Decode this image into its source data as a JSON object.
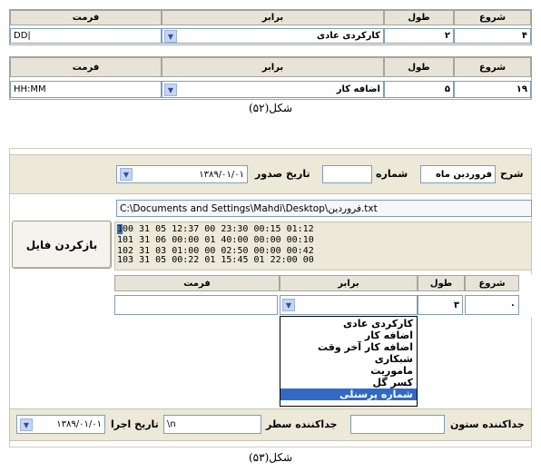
{
  "fig1": {
    "table1": {
      "headers": {
        "start": "شروع",
        "length": "طول",
        "equal": "برابر",
        "format": "فرمت"
      },
      "row": {
        "start": "۴",
        "length": "۲",
        "equal": "کارکردی عادی",
        "format": "DD|"
      }
    },
    "table2": {
      "headers": {
        "start": "شروع",
        "length": "طول",
        "equal": "برابر",
        "format": "فرمت"
      },
      "row": {
        "start": "۱۹",
        "length": "۵",
        "equal": "اضافه کار",
        "format": "HH:MM"
      }
    },
    "caption": "شکل(۵۲)"
  },
  "fig2": {
    "header": {
      "description_label": "شرح",
      "description_value": "فروردین ماه",
      "number_label": "شماره",
      "number_value": "",
      "issue_date_label": "تاریخ صدور",
      "issue_date_value": "۱۳۸۹/۰۱/۰۱"
    },
    "path": "C:\\Documents and Settings\\Mahdi\\Desktop\\فروردین.txt",
    "open_file_button": "بازکردن فایل",
    "file_lines": [
      "100 31 05 12:37 00 23:30 00:15 01:12",
      "101 31 06 00:00 01 40:00 00:00 00:10",
      "102 31 03 01:00 00 02:50 00:00 00:42",
      "103 31 05 00:22 01 15:45 01 22:00 00"
    ],
    "mapping": {
      "headers": {
        "start": "شروع",
        "length": "طول",
        "equal": "برابر",
        "format": "فرمت"
      },
      "row": {
        "start": "۰",
        "length": "۳",
        "equal": "",
        "format": ""
      }
    },
    "dropdown_options": [
      "کارکردی عادی",
      "اضافه کار",
      "اضافه کار آخر وقت",
      "شبکاری",
      "ماموریت",
      "کسر گل",
      "شماره پرسنلی"
    ],
    "selected_option_index": 6,
    "footer": {
      "column_sep_label": "جداکننده ستون",
      "column_sep_value": "",
      "row_sep_label": "جداکننده سطر",
      "row_sep_value": "\\n",
      "run_date_label": "تاریخ اجرا",
      "run_date_value": "۱۳۸۹/۰۱/۰۱"
    },
    "caption": "شکل(۵۳)"
  }
}
